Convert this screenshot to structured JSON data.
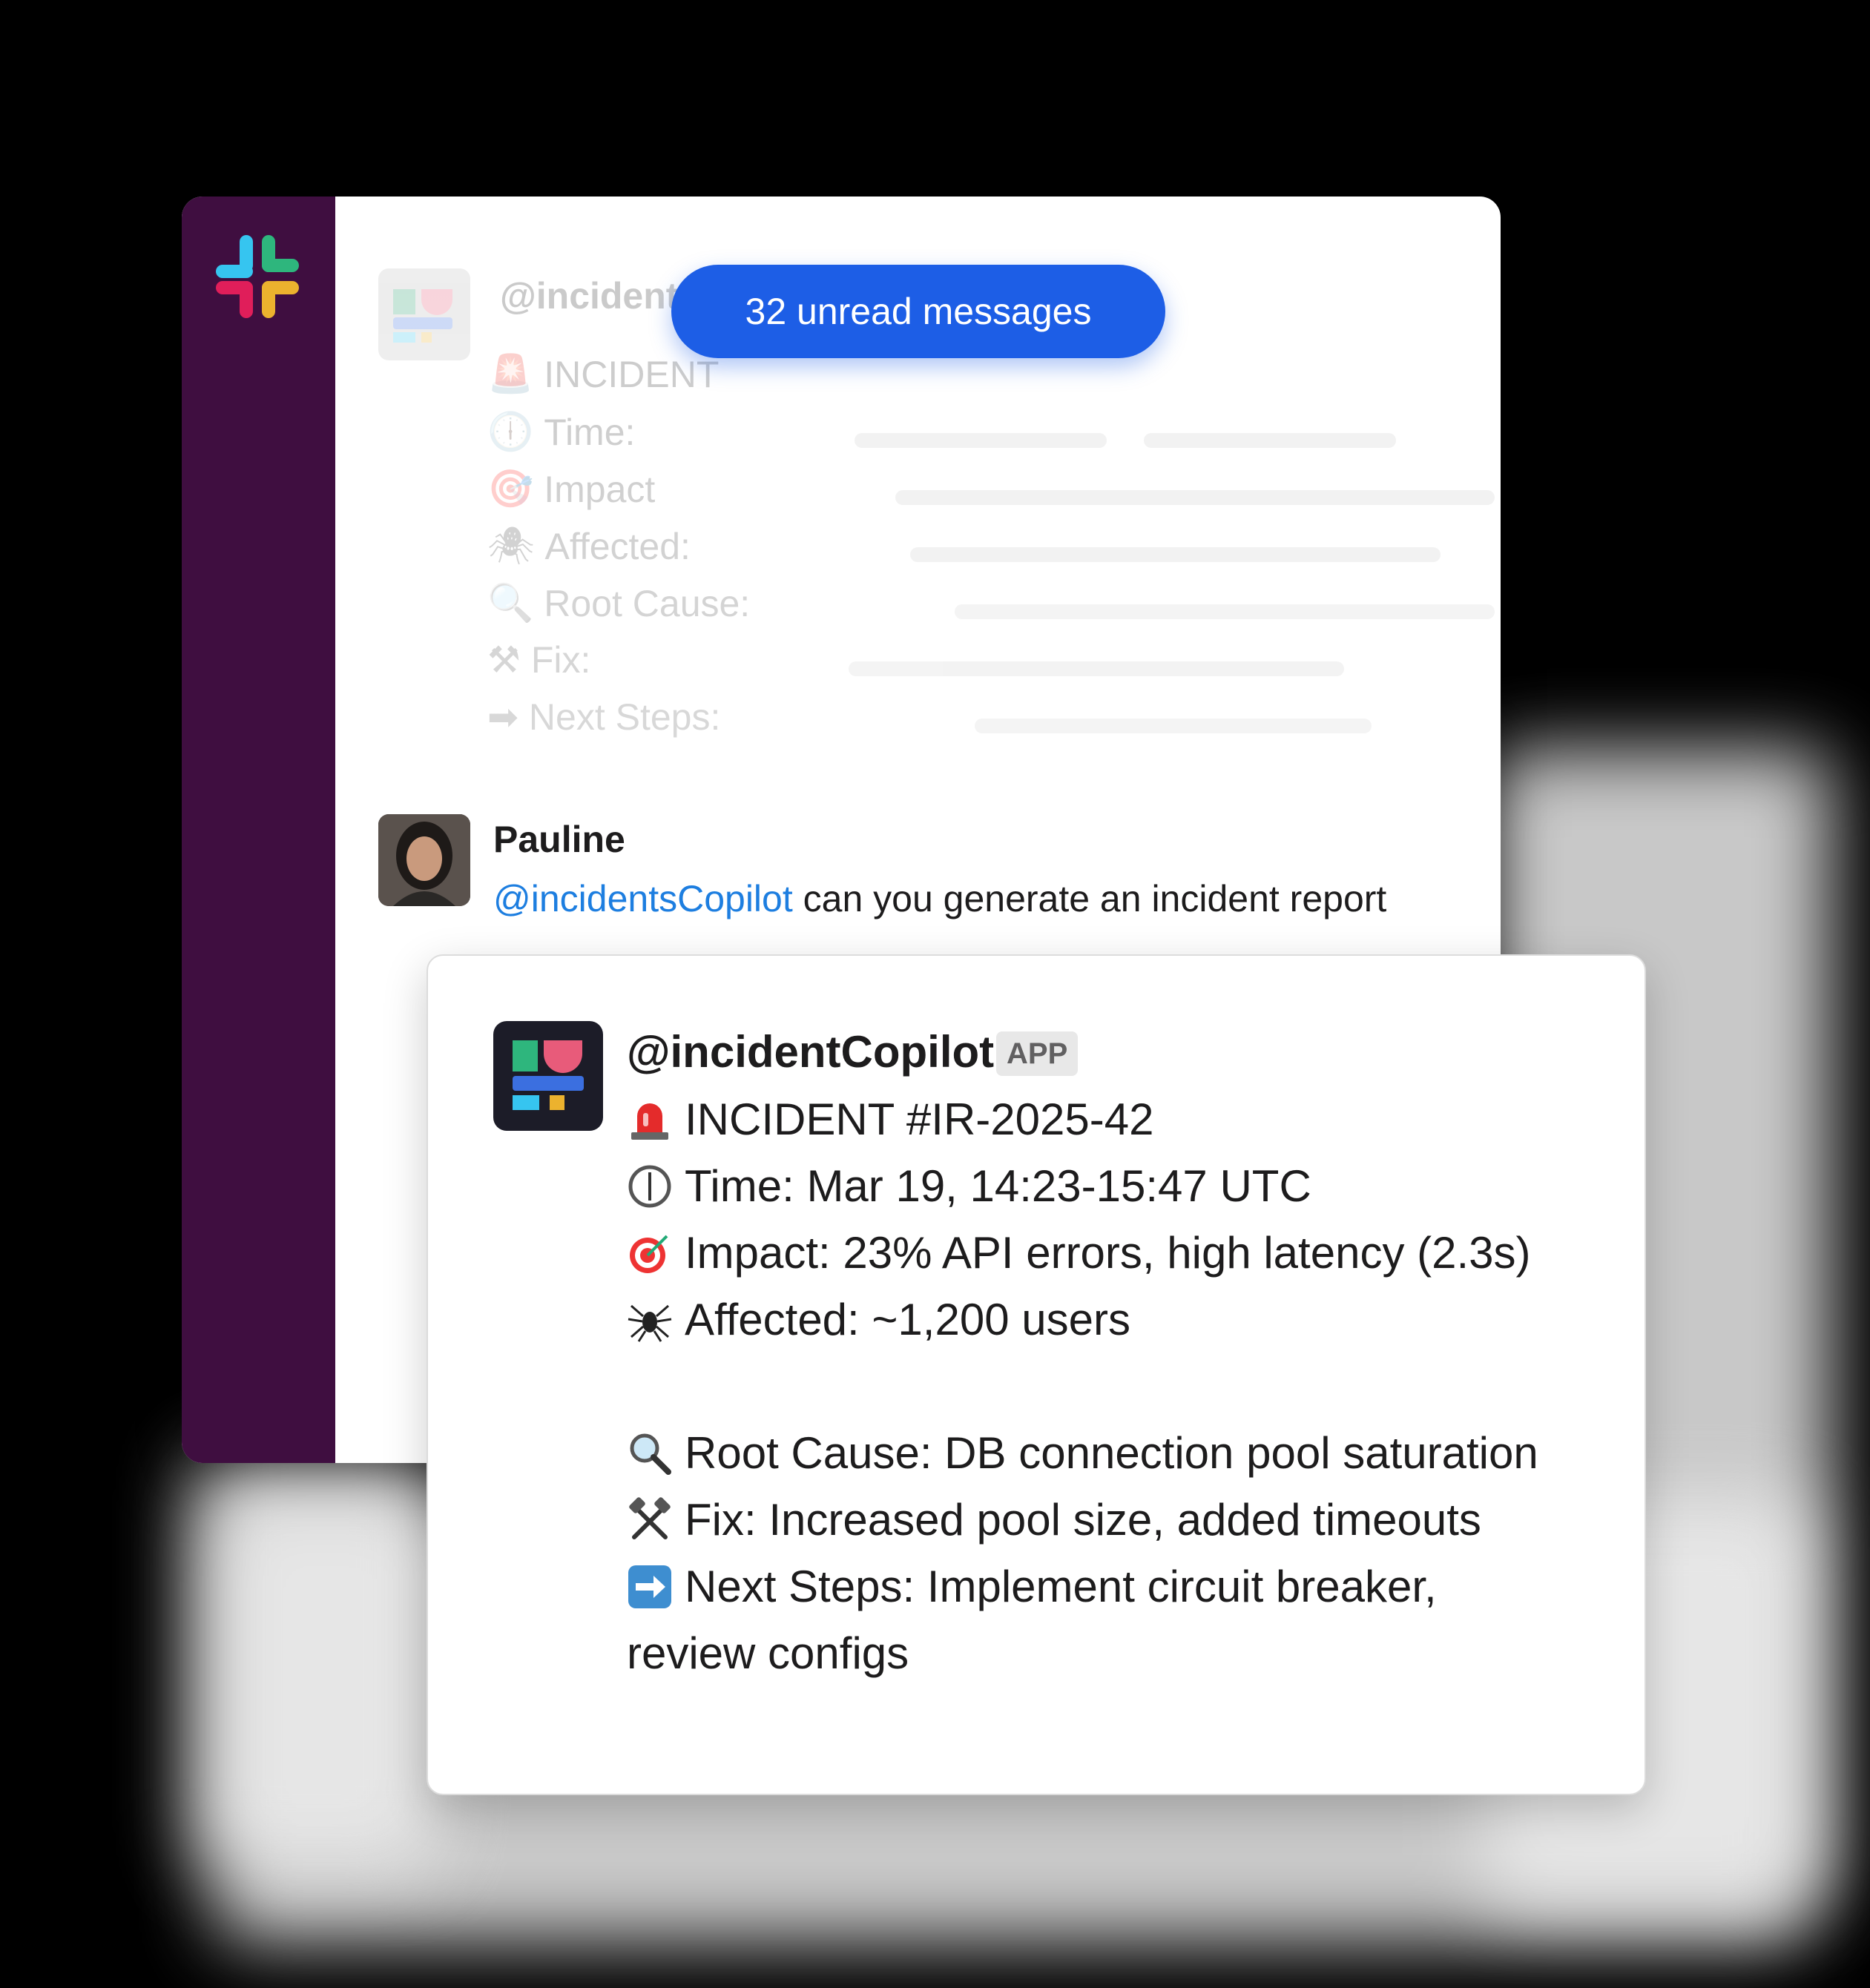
{
  "unread": {
    "label": "32 unread messages"
  },
  "ghost_message": {
    "author": "@incident",
    "lines": [
      {
        "label": "INCIDENT"
      },
      {
        "label": "Time:"
      },
      {
        "label": "Impact"
      },
      {
        "label": "Affected:"
      },
      {
        "label": "Root Cause:"
      },
      {
        "label": "Fix:"
      },
      {
        "label": "Next Steps:"
      }
    ]
  },
  "user_message": {
    "author": "Pauline",
    "mention": "@incidentsCopilot",
    "text": " can you generate an incident report"
  },
  "bot_message": {
    "author": "@incidentCopilot",
    "badge": "APP",
    "lines": [
      {
        "icon": "siren-icon",
        "text": "INCIDENT #IR-2025-42"
      },
      {
        "icon": "clock-icon",
        "text": "Time: Mar 19, 14:23-15:47 UTC"
      },
      {
        "icon": "target-icon",
        "text": "Impact: 23% API errors, high latency (2.3s)"
      },
      {
        "icon": "bug-icon",
        "text": "Affected: ~1,200 users"
      },
      {
        "icon": "magnifier-icon",
        "text": "Root Cause: DB connection pool saturation"
      },
      {
        "icon": "tools-icon",
        "text": "Fix: Increased pool size, added timeouts"
      },
      {
        "icon": "arrow-right-icon",
        "text": "Next Steps: Implement circuit breaker,"
      }
    ],
    "continuation": "review configs"
  },
  "colors": {
    "sidebar": "#3f0e40",
    "pill": "#1d5ee6",
    "mention": "#1d7ee0"
  }
}
